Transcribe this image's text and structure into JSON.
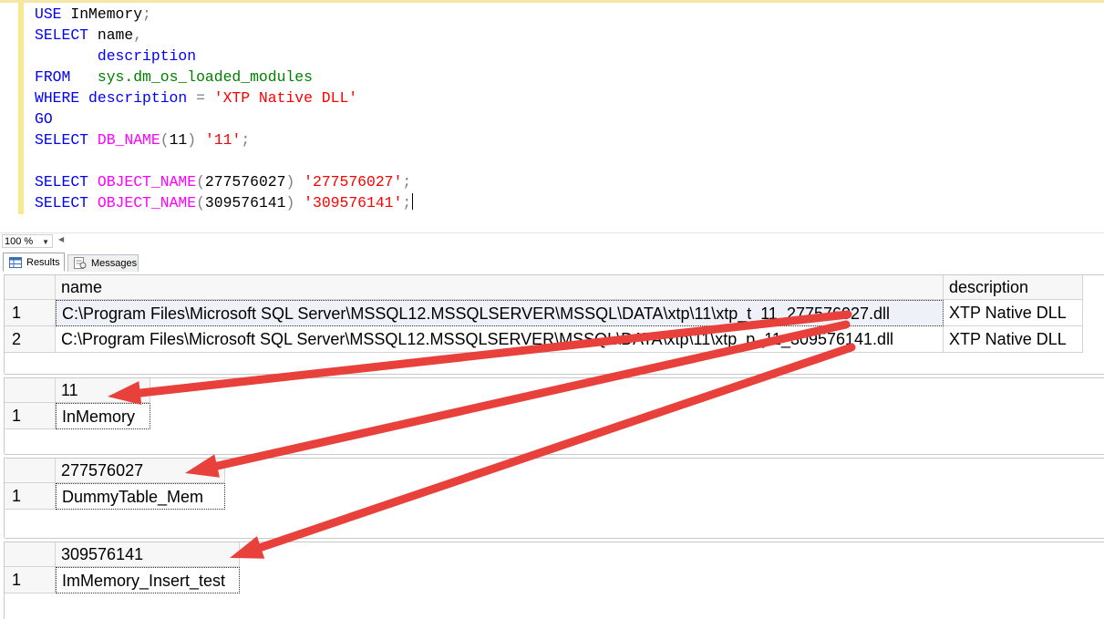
{
  "editor": {
    "lines": [
      [
        {
          "t": "USE",
          "c": "kw"
        },
        {
          "t": " InMemory",
          "c": ""
        },
        {
          "t": ";",
          "c": "op"
        }
      ],
      [
        {
          "t": "SELECT",
          "c": "kw"
        },
        {
          "t": " name",
          "c": ""
        },
        {
          "t": ",",
          "c": "op"
        }
      ],
      [
        {
          "t": "       ",
          "c": ""
        },
        {
          "t": "description",
          "c": "kw"
        }
      ],
      [
        {
          "t": "FROM",
          "c": "kw"
        },
        {
          "t": "   ",
          "c": ""
        },
        {
          "t": "sys.dm_os_loaded_modules",
          "c": "sys"
        }
      ],
      [
        {
          "t": "WHERE",
          "c": "kw"
        },
        {
          "t": " ",
          "c": ""
        },
        {
          "t": "description",
          "c": "kw"
        },
        {
          "t": " = ",
          "c": "op"
        },
        {
          "t": "'XTP Native DLL'",
          "c": "str"
        }
      ],
      [
        {
          "t": "GO",
          "c": "kw"
        }
      ],
      [
        {
          "t": "SELECT",
          "c": "kw"
        },
        {
          "t": " ",
          "c": ""
        },
        {
          "t": "DB_NAME",
          "c": "fn"
        },
        {
          "t": "(",
          "c": "op"
        },
        {
          "t": "11",
          "c": ""
        },
        {
          "t": ")",
          "c": "op"
        },
        {
          "t": " ",
          "c": ""
        },
        {
          "t": "'11'",
          "c": "str"
        },
        {
          "t": ";",
          "c": "op"
        }
      ],
      [],
      [
        {
          "t": "SELECT",
          "c": "kw"
        },
        {
          "t": " ",
          "c": ""
        },
        {
          "t": "OBJECT_NAME",
          "c": "fn"
        },
        {
          "t": "(",
          "c": "op"
        },
        {
          "t": "277576027",
          "c": ""
        },
        {
          "t": ")",
          "c": "op"
        },
        {
          "t": " ",
          "c": ""
        },
        {
          "t": "'277576027'",
          "c": "str"
        },
        {
          "t": ";",
          "c": "op"
        }
      ],
      [
        {
          "t": "SELECT",
          "c": "kw"
        },
        {
          "t": " ",
          "c": ""
        },
        {
          "t": "OBJECT_NAME",
          "c": "fn"
        },
        {
          "t": "(",
          "c": "op"
        },
        {
          "t": "309576141",
          "c": ""
        },
        {
          "t": ")",
          "c": "op"
        },
        {
          "t": " ",
          "c": ""
        },
        {
          "t": "'309576141'",
          "c": "str"
        },
        {
          "t": ";",
          "c": "op"
        }
      ]
    ]
  },
  "zoom": {
    "value": "100 %"
  },
  "tabs": {
    "results": "Results",
    "messages": "Messages"
  },
  "grid1": {
    "headers": [
      "name",
      "description"
    ],
    "rows": [
      {
        "num": "1",
        "name": "C:\\Program Files\\Microsoft SQL Server\\MSSQL12.MSSQLSERVER\\MSSQL\\DATA\\xtp\\11\\xtp_t_11_277576027.dll",
        "description": "XTP Native DLL"
      },
      {
        "num": "2",
        "name": "C:\\Program Files\\Microsoft SQL Server\\MSSQL12.MSSQLSERVER\\MSSQL\\DATA\\xtp\\11\\xtp_p_11_309576141.dll",
        "description": "XTP Native DLL"
      }
    ]
  },
  "grid2": {
    "header": "11",
    "num": "1",
    "value": "InMemory"
  },
  "grid3": {
    "header": "277576027",
    "num": "1",
    "value": "DummyTable_Mem"
  },
  "grid4": {
    "header": "309576141",
    "num": "1",
    "value": "ImMemory_Insert_test"
  },
  "colors": {
    "arrow": "#e8403a",
    "keyword": "#0000ff",
    "function": "#ff00ff",
    "system": "#008000",
    "string": "#ff0000"
  }
}
